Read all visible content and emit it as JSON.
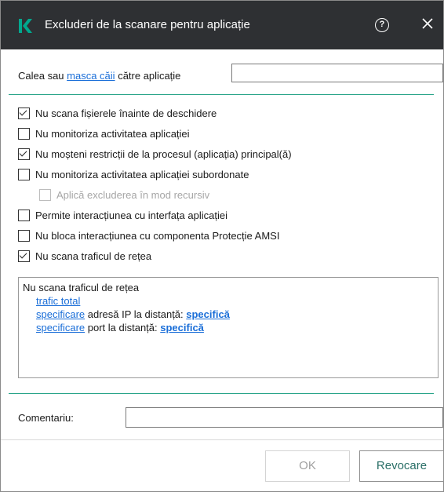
{
  "window": {
    "title": "Excluderi de la scanare pentru aplicație",
    "colors": {
      "titlebar": "#2e3033",
      "logo": "#00a88e",
      "accent_line": "#2aa58a",
      "link": "#1a6ed8"
    },
    "icons": {
      "logo": "kaspersky-k-logo",
      "help": "help-icon",
      "close": "close-icon"
    },
    "help_glyph": "?"
  },
  "path": {
    "label_before": "Calea sau ",
    "label_link": "masca căii",
    "label_after": " către aplicație",
    "value": ""
  },
  "options": [
    {
      "label": "Nu scana fișierele înainte de deschidere",
      "checked": true,
      "disabled": false
    },
    {
      "label": "Nu monitoriza activitatea aplicației",
      "checked": false,
      "disabled": false
    },
    {
      "label": "Nu moșteni restricții de la procesul (aplicația) principal(ă)",
      "checked": true,
      "disabled": false
    },
    {
      "label": "Nu monitoriza activitatea aplicației subordonate",
      "checked": false,
      "disabled": false
    },
    {
      "label": "Aplică excluderea în mod recursiv",
      "checked": false,
      "disabled": true
    },
    {
      "label": "Permite interacțiunea cu interfața aplicației",
      "checked": false,
      "disabled": false
    },
    {
      "label": "Nu bloca interacțiunea cu componenta Protecție AMSI",
      "checked": false,
      "disabled": false
    },
    {
      "label": "Nu scana traficul de rețea",
      "checked": true,
      "disabled": false
    }
  ],
  "traffic": {
    "heading": "Nu scana traficul de rețea",
    "total_link": "trafic total",
    "ip_specify": "specificare",
    "ip_text": " adresă IP la distanță: ",
    "ip_value": "specifică",
    "port_specify": "specificare",
    "port_text": " port la distanță: ",
    "port_value": "specifică"
  },
  "comment": {
    "label": "Comentariu:",
    "value": ""
  },
  "buttons": {
    "ok": "OK",
    "cancel": "Revocare"
  }
}
